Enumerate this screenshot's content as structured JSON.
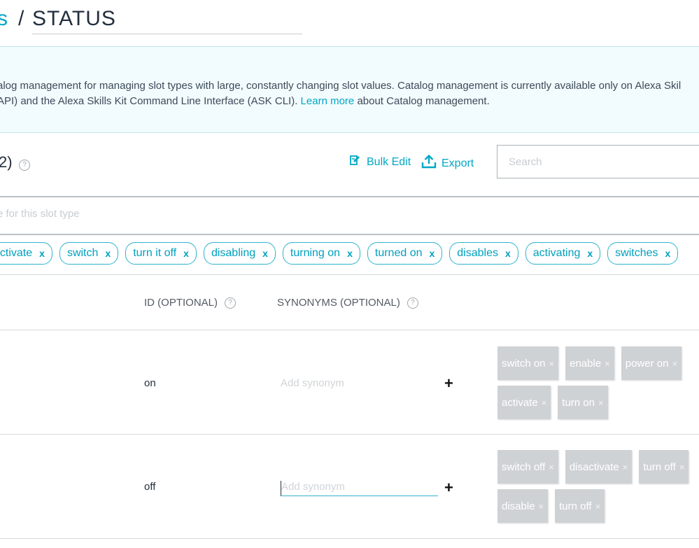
{
  "header": {
    "breadcrumb_link": "s",
    "separator": "/",
    "title": "STATUS"
  },
  "banner": {
    "line1": "alog management for managing slot types with large, constantly changing slot values. Catalog management is currently available only on Alexa Skil",
    "line2_pre": "API) and the Alexa Skills Kit Command Line Interface (ASK CLI).",
    "link": "Learn more",
    "line2_post": "about Catalog management."
  },
  "toolbar": {
    "count": "2)",
    "help": "?",
    "bulk_edit": "Bulk Edit",
    "export": "Export",
    "search_placeholder": "Search"
  },
  "value_input": {
    "placeholder": "e for this slot type"
  },
  "chips": [
    {
      "label": "activate",
      "x": "x"
    },
    {
      "label": "switch",
      "x": "x"
    },
    {
      "label": "turn it off",
      "x": "x"
    },
    {
      "label": "disabling",
      "x": "x"
    },
    {
      "label": "turning on",
      "x": "x"
    },
    {
      "label": "turned on",
      "x": "x"
    },
    {
      "label": "disables",
      "x": "x"
    },
    {
      "label": "activating",
      "x": "x"
    },
    {
      "label": "switches",
      "x": "x"
    }
  ],
  "columns": {
    "id": "ID (OPTIONAL)",
    "synonyms": "SYNONYMS (OPTIONAL)"
  },
  "rows": [
    {
      "id": "on",
      "synonym_placeholder": "Add synonym",
      "plus": "+",
      "tags": [
        "switch on",
        "enable",
        "power on",
        "activate",
        "turn on"
      ]
    },
    {
      "id": "off",
      "synonym_placeholder": "Add synonym",
      "plus": "+",
      "tags": [
        "switch off",
        "disactivate",
        "turn off",
        "disable",
        "turn off"
      ]
    }
  ],
  "tag_close": "×",
  "colors": {
    "accent": "#00a8c6",
    "banner_bg": "#f2fbfd",
    "tag_bg": "#cfd2d4"
  }
}
